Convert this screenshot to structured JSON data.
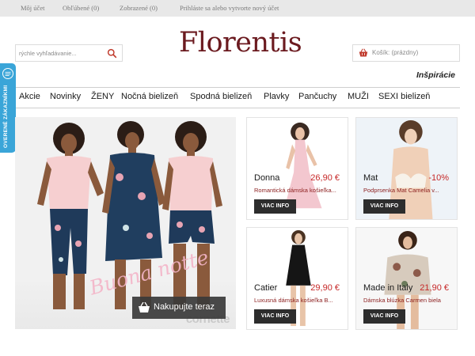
{
  "topbar": {
    "links": [
      {
        "label": "Môj účet"
      },
      {
        "label": "Obľúbené (0)"
      },
      {
        "label": "Zobrazené (0)"
      },
      {
        "label": "Prihláste sa alebo vytvorte nový účet"
      }
    ]
  },
  "search": {
    "placeholder": "rýchle vyhľadávanie..."
  },
  "logo": {
    "text": "Florentis",
    "color": "#6b1a1f"
  },
  "cart": {
    "label": "Košík: (prázdny)"
  },
  "inspiration_link": "Inšpirácie",
  "nav": {
    "items": [
      {
        "label": "Akcie"
      },
      {
        "label": "Novinky"
      },
      {
        "label": "ŽENY"
      },
      {
        "label": "Nočná bielizeň"
      },
      {
        "label": "Spodná bielizeň"
      },
      {
        "label": "Plavky"
      },
      {
        "label": "Pančuchy"
      },
      {
        "label": "MUŽI"
      },
      {
        "label": "SEXI bielizeň"
      }
    ]
  },
  "badge": {
    "text": "OVERENÉ ZÁKAZNÍKMI",
    "color": "#3aa5d8"
  },
  "hero": {
    "script_text": "Buona notte",
    "brand_watermark": "cornette",
    "button_label": "Nakupujte teraz"
  },
  "products": [
    {
      "name": "Donna",
      "price": "26,90 €",
      "description": "Romantická dámska košieľka...",
      "button": "VIAC INFO"
    },
    {
      "name": "Mat",
      "price": "-10%",
      "description": "Podprsenka Mat Camelia v...",
      "button": "VIAC INFO"
    },
    {
      "name": "Catier",
      "price": "29,90 €",
      "description": "Luxusná dámska košieľka B...",
      "button": "VIAC INFO"
    },
    {
      "name": "Made in Italy",
      "price": "21,90 €",
      "description": "Dámska blúzka Carmen biela",
      "button": "VIAC INFO"
    }
  ],
  "colors": {
    "price": "#c62828",
    "accent": "#6b1a1f",
    "button_dark": "#2d2d2d"
  }
}
